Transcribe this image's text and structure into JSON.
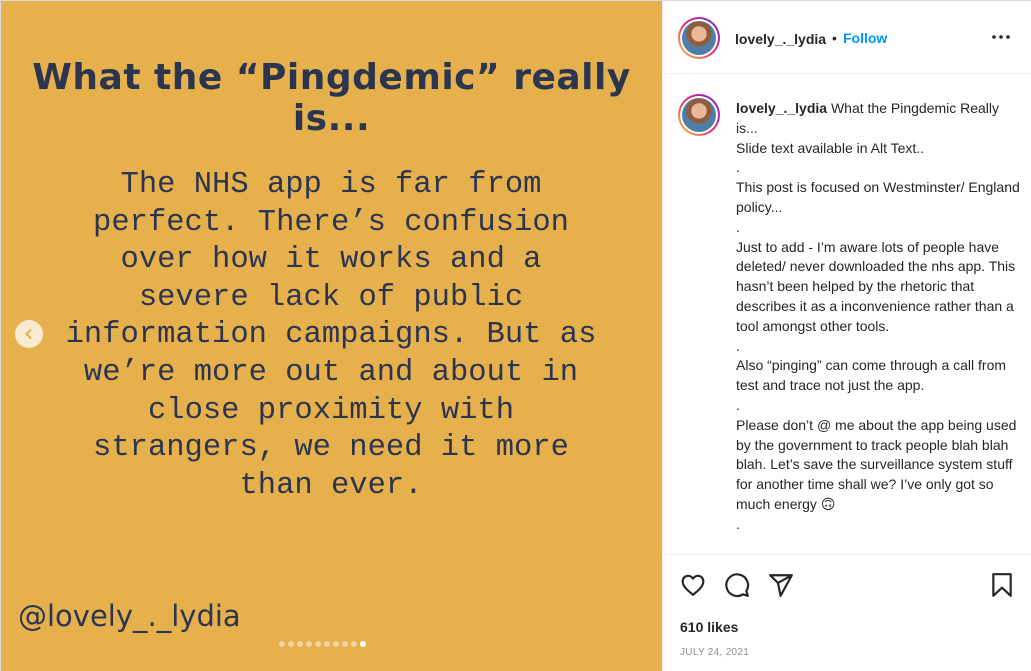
{
  "slide": {
    "title": "What the “Pingdemic” really is...",
    "body": "The NHS app is far from\nperfect. There’s confusion\nover how it works and a\nsevere lack of public\ninformation campaigns. But as\nwe’re more out and about in\nclose proximity with\nstrangers, we need it more\nthan ever.",
    "handle": "@lovely_._lydia",
    "dot_count": 10,
    "active_dot": 9,
    "background_color": "#e6b14d",
    "text_color": "#2c3550"
  },
  "header": {
    "username": "lovely_._lydia",
    "separator": "•",
    "follow_label": "Follow",
    "more_icon": "more-options-icon"
  },
  "caption": {
    "username": "lovely_._lydia",
    "first_line": "What the Pingdemic Really is...",
    "lines": [
      "Slide text available in Alt Text..",
      ".",
      "This post is focused on Westminster/ England policy...",
      ".",
      "Just to add - I’m aware lots of people have deleted/ never downloaded the nhs app. This hasn’t been helped by the rhetoric that describes it as a inconvenience rather than a tool amongst other tools.",
      ".",
      "Also “pinging” can come through a call from test and trace not just the app.",
      ".",
      "Please don’t @ me about the app being used by the government to track people blah blah blah. Let’s save the surveillance system stuff for another time shall we? I’ve only got so much energy 🙃",
      "."
    ]
  },
  "actions": {
    "like_icon": "heart-icon",
    "comment_icon": "comment-icon",
    "share_icon": "share-icon",
    "save_icon": "bookmark-icon"
  },
  "likes": "610 likes",
  "date": "JULY 24, 2021",
  "colors": {
    "accent": "#0095f6",
    "muted": "#8e8e8e"
  }
}
